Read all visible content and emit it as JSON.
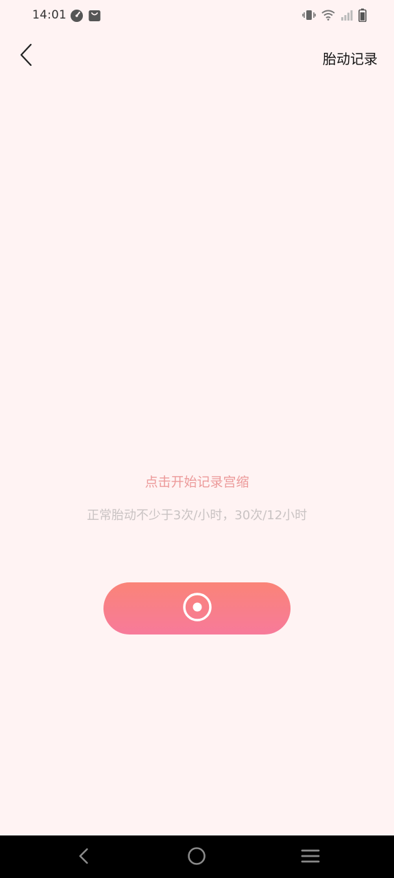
{
  "status_bar": {
    "time": "14:01",
    "icons_left": [
      "speedometer-icon",
      "shopping-bag-icon"
    ],
    "icons_right": [
      "vibrate-icon",
      "wifi-icon",
      "signal-icon",
      "battery-icon"
    ]
  },
  "header": {
    "back_icon": "chevron-left-icon",
    "record_link": "胎动记录"
  },
  "main": {
    "hint_title": "点击开始记录宫缩",
    "hint_subtitle": "正常胎动不少于3次/小时，30次/12小时",
    "record_button_icon": "record-circle-icon"
  },
  "nav_bar": {
    "icons": [
      "back-triangle-icon",
      "home-circle-icon",
      "menu-icon"
    ]
  },
  "colors": {
    "background": "#FFF3F3",
    "hint_title": "#EC9A9A",
    "hint_subtitle": "#C9C3C3",
    "button_gradient_top": "#FA8478",
    "button_gradient_bottom": "#F77A9A"
  }
}
